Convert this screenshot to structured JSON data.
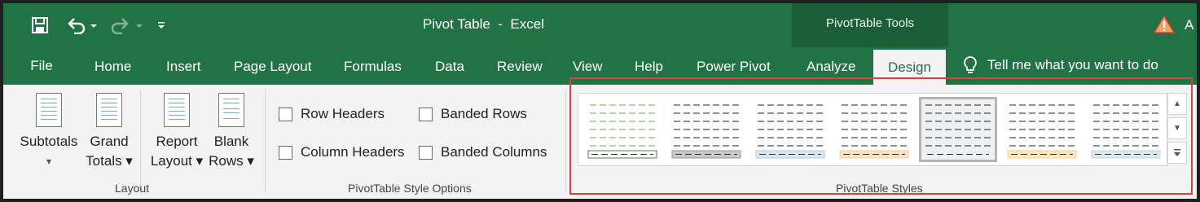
{
  "window": {
    "title": "Pivot Table  -  Excel",
    "account_initial": "A"
  },
  "quick_access": {
    "save": "save-icon",
    "undo": "undo-icon",
    "redo": "redo-icon",
    "customize": "customize-qat-icon"
  },
  "context_tab_group": {
    "label": "PivotTable Tools"
  },
  "tabs": [
    {
      "label": "File"
    },
    {
      "label": "Home"
    },
    {
      "label": "Insert"
    },
    {
      "label": "Page Layout"
    },
    {
      "label": "Formulas"
    },
    {
      "label": "Data"
    },
    {
      "label": "Review"
    },
    {
      "label": "View"
    },
    {
      "label": "Help"
    },
    {
      "label": "Power Pivot"
    },
    {
      "label": "Analyze"
    },
    {
      "label": "Design"
    }
  ],
  "active_tab": "Design",
  "tell_me": {
    "placeholder": "Tell me what you want to do"
  },
  "layout_group": {
    "label": "Layout",
    "buttons": [
      {
        "line1": "Subtotals",
        "line2": "▾"
      },
      {
        "line1": "Grand",
        "line2": "Totals ▾"
      },
      {
        "line1": "Report",
        "line2": "Layout ▾"
      },
      {
        "line1": "Blank",
        "line2": "Rows ▾"
      }
    ]
  },
  "style_options_group": {
    "label": "PivotTable Style Options",
    "options": [
      {
        "label": "Row Headers",
        "checked": false
      },
      {
        "label": "Banded Rows",
        "checked": false
      },
      {
        "label": "Column Headers",
        "checked": false
      },
      {
        "label": "Banded Columns",
        "checked": false
      }
    ]
  },
  "styles_group": {
    "label": "PivotTable Styles",
    "swatches": [
      {
        "name": "green-light",
        "line_color": "#6aa84f",
        "total_fill": "#ffffff",
        "total_border": "#548235",
        "selected": false
      },
      {
        "name": "gray-light",
        "line_color": "#222222",
        "total_fill": "#c9c9c9",
        "total_border": "#9a9a9a",
        "selected": false
      },
      {
        "name": "blue-light",
        "line_color": "#222222",
        "total_fill": "#dce6ee",
        "total_border": "#b8cbd9",
        "selected": false
      },
      {
        "name": "orange-light",
        "line_color": "#222222",
        "total_fill": "#fbe3c8",
        "total_border": "#f3c99b",
        "selected": false
      },
      {
        "name": "none-selected",
        "line_color": "#222222",
        "total_fill": "#eef0f2",
        "total_border": "#eef0f2",
        "selected": true
      },
      {
        "name": "gold-light",
        "line_color": "#222222",
        "total_fill": "#fde7c1",
        "total_border": "#f6d18c",
        "selected": false
      },
      {
        "name": "blue-gray-light",
        "line_color": "#222222",
        "total_fill": "#dde8ee",
        "total_border": "#c1d4df",
        "selected": false
      }
    ],
    "scroll_up": "scroll-up-icon",
    "scroll_down": "scroll-down-icon",
    "more": "gallery-more-icon"
  },
  "colors": {
    "brand_green": "#217346",
    "context_green": "#1b5e38",
    "highlight_red": "#d9433d"
  }
}
